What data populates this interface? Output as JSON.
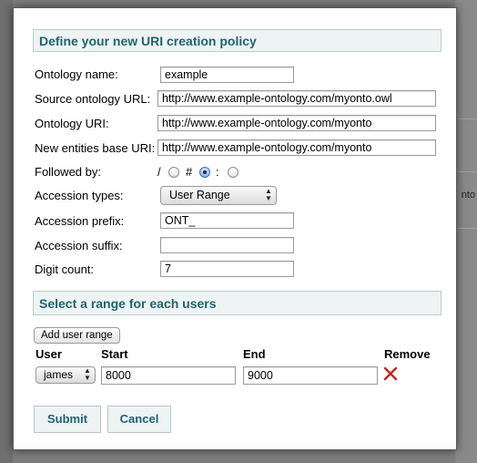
{
  "policy_section": {
    "title": "Define your new URI creation policy"
  },
  "fields": {
    "ontology_name": {
      "label": "Ontology name:",
      "value": "example"
    },
    "source_url": {
      "label": "Source ontology URL:",
      "value": "http://www.example-ontology.com/myonto.owl"
    },
    "ontology_uri": {
      "label": "Ontology URI:",
      "value": "http://www.example-ontology.com/myonto"
    },
    "entities_base_uri": {
      "label": "New entities base URI:",
      "value": "http://www.example-ontology.com/myonto"
    },
    "followed_by": {
      "label": "Followed by:",
      "options": [
        {
          "symbol": "/",
          "selected": false
        },
        {
          "symbol": "#",
          "selected": true
        },
        {
          "symbol": ":",
          "selected": false
        }
      ]
    },
    "accession_types": {
      "label": "Accession types:",
      "value": "User Range"
    },
    "accession_prefix": {
      "label": "Accession prefix:",
      "value": "ONT_"
    },
    "accession_suffix": {
      "label": "Accession suffix:",
      "value": ""
    },
    "digit_count": {
      "label": "Digit count:",
      "value": "7"
    }
  },
  "range_section": {
    "title": "Select a range for each users",
    "add_button": "Add user range",
    "columns": {
      "user": "User",
      "start": "Start",
      "end": "End",
      "remove": "Remove"
    },
    "rows": [
      {
        "user": "james",
        "start": "8000",
        "end": "9000"
      }
    ]
  },
  "actions": {
    "submit": "Submit",
    "cancel": "Cancel"
  },
  "background": {
    "partial_text": "nto"
  },
  "colors": {
    "accent": "#1f6470",
    "header_bg": "#eef3f3",
    "remove_icon": "#cc2222"
  }
}
